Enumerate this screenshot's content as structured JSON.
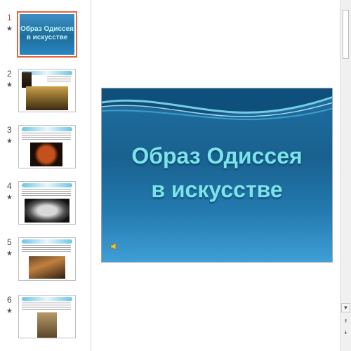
{
  "thumbnails": [
    {
      "number": "1",
      "star": "★",
      "title": "Образ Одиссея в искусстве",
      "selected": true
    },
    {
      "number": "2",
      "star": "★",
      "selected": false
    },
    {
      "number": "3",
      "star": "★",
      "selected": false
    },
    {
      "number": "4",
      "star": "★",
      "selected": false
    },
    {
      "number": "5",
      "star": "★",
      "selected": false
    },
    {
      "number": "6",
      "star": "★",
      "selected": false
    }
  ],
  "main_slide": {
    "title_line1": "Образ Одиссея",
    "title_line2": "в искусстве",
    "sound_icon": "speaker-icon"
  },
  "scrollbar": {
    "up_glyph": "▲",
    "down_glyph": "▼",
    "prev_glyph": "⯭",
    "next_glyph": "⯯"
  },
  "colors": {
    "selection_border": "#e8643c",
    "slide_title": "#7de3ea",
    "slide_background": "#1f6ea0"
  }
}
